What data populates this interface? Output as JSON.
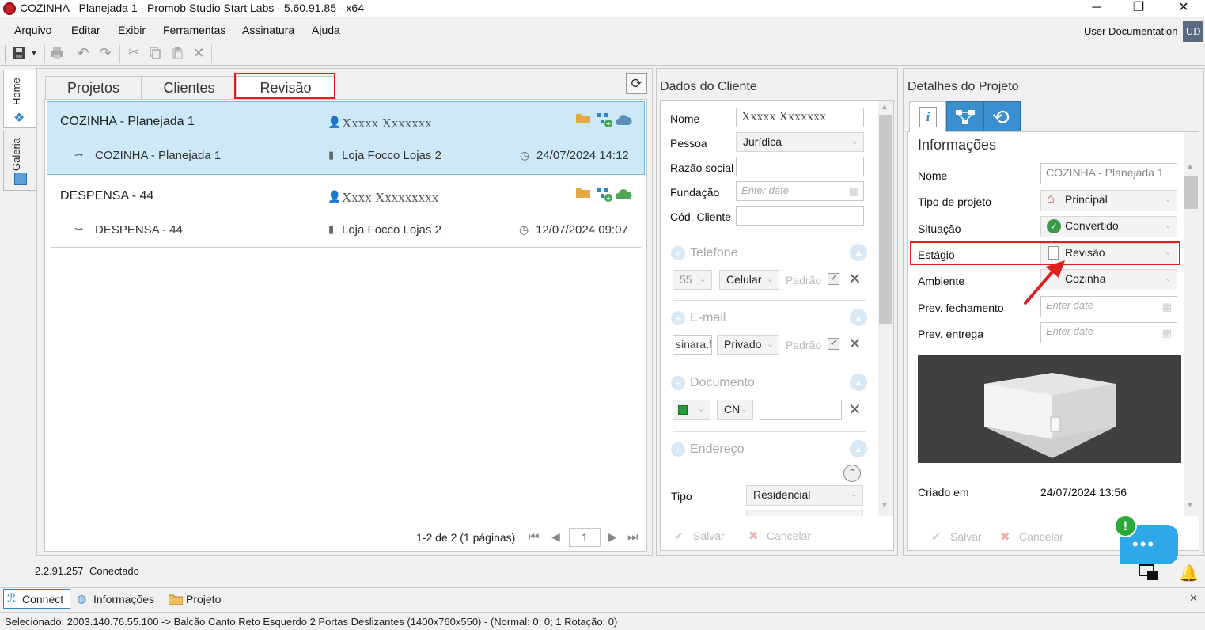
{
  "window": {
    "title": "COZINHA - Planejada 1 - Promob Studio Start Labs - 5.60.91.85 - x64",
    "minimize": "─",
    "maximize": "❐",
    "close": "✕"
  },
  "menu": [
    "Arquivo",
    "Editar",
    "Exibir",
    "Ferramentas",
    "Assinatura",
    "Ajuda"
  ],
  "user": {
    "name": "User Documentation",
    "initials": "UD"
  },
  "side_tabs": [
    "Home",
    "Galeria"
  ],
  "tabs": [
    "Projetos",
    "Clientes",
    "Revisão"
  ],
  "projects": [
    {
      "name": "COZINHA - Planejada 1",
      "client": "Xxxxx Xxxxxxx",
      "sub_name": "COZINHA - Planejada 1",
      "store": "Loja Focco Lojas 2",
      "date": "24/07/2024 14:12"
    },
    {
      "name": "DESPENSA - 44",
      "client": "Xxxx Xxxxxxxxx",
      "sub_name": "DESPENSA - 44",
      "store": "Loja Focco Lojas 2",
      "date": "12/07/2024 09:07"
    }
  ],
  "pagination": {
    "text": "1-2 de 2 (1 páginas)",
    "page": "1"
  },
  "client_panel": {
    "header": "Dados do Cliente",
    "labels": {
      "nome": "Nome",
      "pessoa": "Pessoa",
      "razao": "Razão social",
      "fundacao": "Fundação",
      "cod": "Cód. Cliente",
      "tipo": "Tipo"
    },
    "values": {
      "nome": "Xxxxx Xxxxxxx",
      "pessoa": "Jurídica",
      "fundacao_placeholder": "Enter date",
      "tipo": "Residencial"
    },
    "sections": {
      "telefone": "Telefone",
      "email": "E-mail",
      "documento": "Documento",
      "endereco": "Endereço"
    },
    "phone": {
      "ddd": "55",
      "type": "Celular",
      "padrao": "Padrão"
    },
    "email": {
      "value": "sinara.f",
      "type": "Privado",
      "padrao": "Padrão"
    },
    "documento": {
      "type": "CN"
    },
    "save": "Salvar",
    "cancel": "Cancelar"
  },
  "details_panel": {
    "header": "Detalhes do Projeto",
    "section": "Informações",
    "labels": {
      "nome": "Nome",
      "tipo": "Tipo de projeto",
      "situacao": "Situação",
      "estagio": "Estágio",
      "ambiente": "Ambiente",
      "prev_fech": "Prev. fechamento",
      "prev_entrega": "Prev. entrega",
      "criado": "Criado em"
    },
    "values": {
      "nome": "COZINHA - Planejada 1",
      "tipo": "Principal",
      "situacao": "Convertido",
      "estagio": "Revisão",
      "ambiente": "Cozinha",
      "prev_fech_placeholder": "Enter date",
      "prev_entrega_placeholder": "Enter date",
      "criado": "24/07/2024 13:56"
    },
    "save": "Salvar",
    "cancel": "Cancelar"
  },
  "status": {
    "connection": "2.2.91.257",
    "state": "Conectado"
  },
  "bottom_tabs": [
    "Connect",
    "Informações",
    "Projeto"
  ],
  "selection_status": "Selecionado: 2003.140.76.55.100 -> Balcão Canto Reto Esquerdo 2 Portas Deslizantes (1400x760x550) - (Normal: 0; 0; 1 Rotação: 0)",
  "colors": {
    "highlight": "#e02020",
    "selected_row": "#cde8f7",
    "accent": "#2e87c8"
  }
}
